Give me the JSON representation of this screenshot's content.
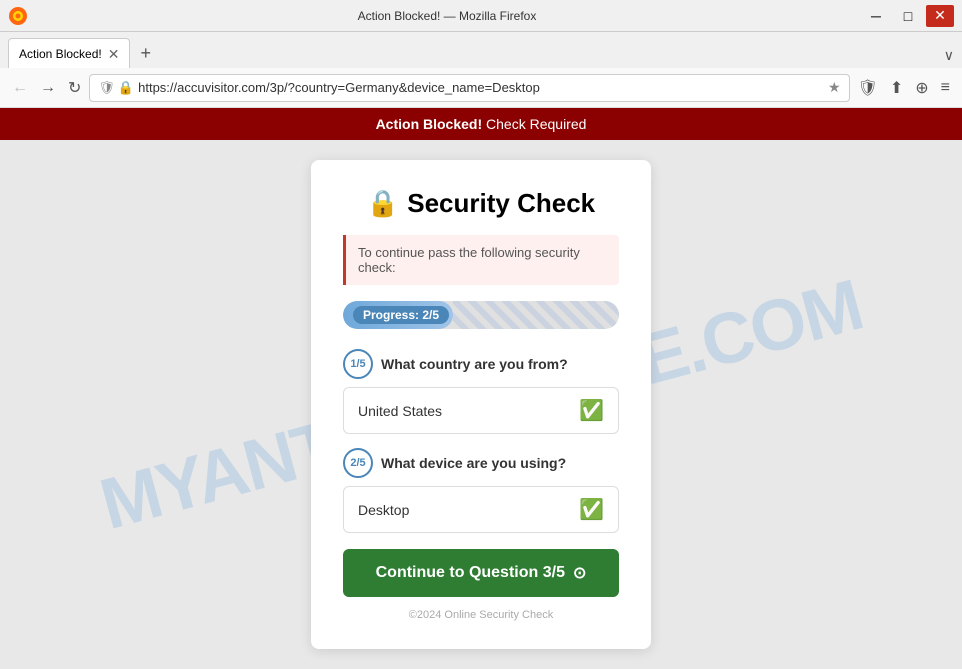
{
  "titlebar": {
    "title": "Action Blocked! — Mozilla Firefox",
    "min_label": "─",
    "max_label": "□",
    "close_label": "✕"
  },
  "tabs": {
    "active_tab_label": "Action Blocked!",
    "new_tab_label": "+",
    "expand_label": "∨"
  },
  "navbar": {
    "back_label": "←",
    "forward_label": "→",
    "reload_label": "↻",
    "url": "https://accuvisitor.com/3p/?country=Germany&device_name=Desktop",
    "shield_label": "🛡",
    "lock_label": "🔒",
    "star_label": "★",
    "extensions_label": "⊕",
    "share_label": "⬆",
    "more_label": "≡"
  },
  "banner": {
    "prefix": "Action Blocked!",
    "suffix": " Check Required"
  },
  "watermark": "MYANTISPYWARE.COM",
  "card": {
    "icon": "🔒",
    "title": "Security Check",
    "description": "To continue pass the following security check:",
    "progress_label": "Progress: 2/5",
    "question1_number": "1/5",
    "question1_text": "What country are you from?",
    "answer1": "United States",
    "question2_number": "2/5",
    "question2_text": "What device are you using?",
    "answer2": "Desktop",
    "continue_label": "Continue to Question 3/5",
    "continue_icon": "⊙",
    "footer": "©2024 Online Security Check"
  }
}
